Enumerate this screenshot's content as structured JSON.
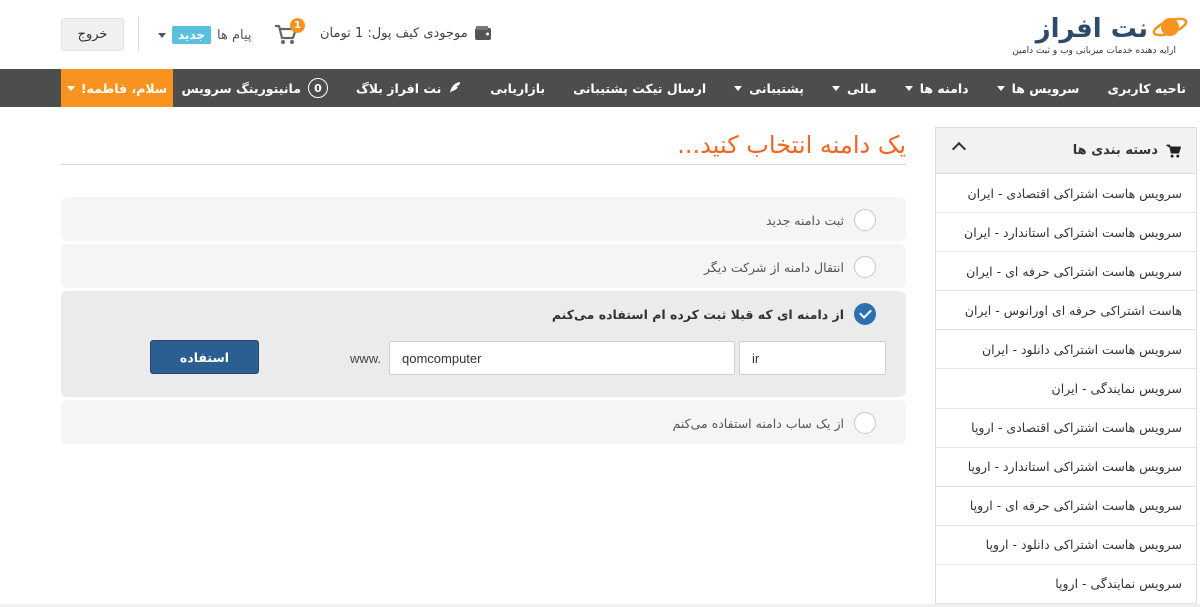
{
  "header": {
    "logo_text": "نت افراز",
    "logo_subtitle": "ارایه دهنده خدمات میزبانی وب و ثبت دامین",
    "logout_label": "خروج",
    "messages_label": "پیام ها",
    "messages_badge": "جدید",
    "cart_count": "1",
    "wallet_label": "موجودی کیف پول: 1 تومان"
  },
  "navbar": {
    "items": [
      {
        "label": "ناحیه کاربری"
      },
      {
        "label": "سرویس ها"
      },
      {
        "label": "دامنه ها"
      },
      {
        "label": "مالی"
      },
      {
        "label": "پشتیبانی"
      },
      {
        "label": "ارسال تیکت پشتیبانی"
      },
      {
        "label": "بازاریابی"
      },
      {
        "label": "نت افراز بلاگ"
      },
      {
        "label": "مانیتورینگ سرویس",
        "count": "0"
      }
    ],
    "greeting": "سلام، فاطمه!"
  },
  "sidebar": {
    "title": "دسته بندی ها",
    "items": [
      "سرویس هاست اشتراکی اقتصادی - ایران",
      "سرویس هاست اشتراکی استاندارد - ایران",
      "سرویس هاست اشتراکی حرفه ای - ایران",
      "هاست اشتراکی حرفه ای اورانوس - ایران",
      "سرویس هاست اشتراکی دانلود - ایران",
      "سرویس نمایندگی - ایران",
      "سرویس هاست اشتراکی اقتصادی - اروپا",
      "سرویس هاست اشتراکی استاندارد - اروپا",
      "سرویس هاست اشتراکی حرفه ای - اروپا",
      "سرویس هاست اشتراکی دانلود - اروپا",
      "سرویس نمایندگی - اروپا"
    ]
  },
  "main": {
    "title": "یک دامنه انتخاب کنید...",
    "options": [
      {
        "label": "ثبت دامنه جدید",
        "checked": false
      },
      {
        "label": "انتقال دامنه از شرکت دیگر",
        "checked": false
      },
      {
        "label": "از دامنه ای که قبلا ثبت کرده ام استفاده می‌کنم",
        "checked": true
      },
      {
        "label": "از یک ساب دامنه استفاده می‌کنم",
        "checked": false
      }
    ],
    "www_prefix": "www.",
    "domain_value": "qomcomputer",
    "tld_value": "ir",
    "use_button": "استفاده"
  },
  "colors": {
    "accent": "#f7931e",
    "title": "#f26522",
    "navbar": "#4d4d4d",
    "primary_button": "#2c5f91",
    "check": "#2a6fb0",
    "badge": "#5bc0de"
  }
}
